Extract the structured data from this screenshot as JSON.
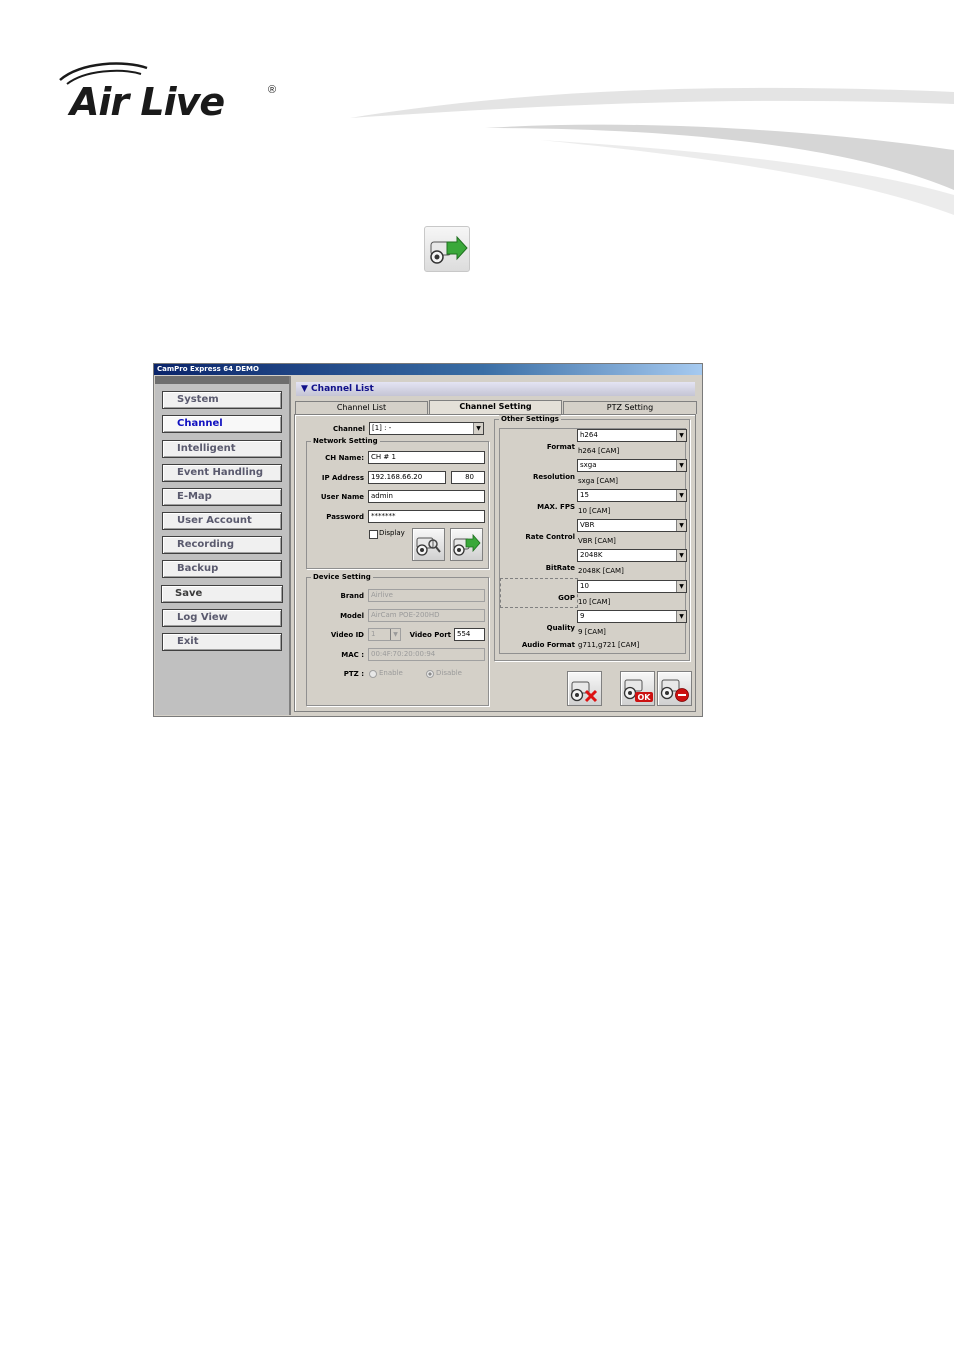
{
  "logo": {
    "text": "Air Live",
    "registered": "®"
  },
  "window": {
    "title": "CamPro Express 64 DEMO"
  },
  "sidebar": {
    "items": [
      {
        "label": "System"
      },
      {
        "label": "Channel"
      },
      {
        "label": "Intelligent"
      },
      {
        "label": "Event Handling"
      },
      {
        "label": "E-Map"
      },
      {
        "label": "User Account"
      },
      {
        "label": "Recording"
      },
      {
        "label": "Backup"
      },
      {
        "label": "Save"
      },
      {
        "label": "Log View"
      },
      {
        "label": "Exit"
      }
    ],
    "active": "Channel"
  },
  "main": {
    "header": "▼ Channel List",
    "tabs": [
      {
        "label": "Channel List"
      },
      {
        "label": "Channel Setting"
      },
      {
        "label": "PTZ Setting"
      }
    ],
    "active_tab": "Channel Setting"
  },
  "channel": {
    "label": "Channel",
    "value": "[1] : -"
  },
  "network": {
    "title": "Network Setting",
    "ch_name_label": "CH Name:",
    "ch_name_value": "CH # 1",
    "ip_label": "IP Address",
    "ip_value": "192.168.66.20",
    "port_value": "80",
    "user_label": "User Name",
    "user_value": "admin",
    "pass_label": "Password",
    "pass_value": "*******",
    "display_label": "Display"
  },
  "device": {
    "title": "Device Setting",
    "brand_label": "Brand",
    "brand_value": "Airlive",
    "model_label": "Model",
    "model_value": "AirCam POE-200HD",
    "video_id_label": "Video ID",
    "video_id_value": "1",
    "video_port_label": "Video Port",
    "video_port_value": "554",
    "mac_label": "MAC :",
    "mac_value": "00:4F:70:20:00:94",
    "ptz_label": "PTZ :",
    "ptz_enable": "Enable",
    "ptz_disable": "Disable"
  },
  "other": {
    "title": "Other Settings",
    "rows": [
      {
        "label": "Format",
        "value": "h264",
        "cam": "h264 [CAM]"
      },
      {
        "label": "Resolution",
        "value": "sxga",
        "cam": "sxga [CAM]"
      },
      {
        "label": "MAX. FPS",
        "value": "15",
        "cam": "10 [CAM]"
      },
      {
        "label": "Rate Control",
        "value": "VBR",
        "cam": "VBR [CAM]"
      },
      {
        "label": "BitRate",
        "value": "2048K",
        "cam": "2048K [CAM]"
      },
      {
        "label": "GOP",
        "value": "10",
        "cam": "10 [CAM]"
      },
      {
        "label": "Quality",
        "value": "9",
        "cam": "9 [CAM]"
      }
    ],
    "audio_label": "Audio Format",
    "audio_value": "g711,g721 [CAM]"
  },
  "colors": {
    "accent": "#1010c0",
    "titlebar": "#0a246a",
    "ok_badge": "#cc1111",
    "arrow_green": "#3aa83a"
  }
}
